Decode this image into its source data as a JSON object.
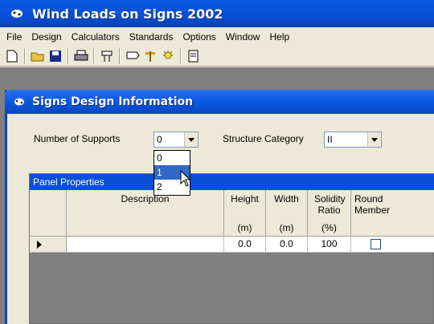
{
  "app": {
    "title": "Wind Loads on Signs 2002"
  },
  "menu": [
    "File",
    "Design",
    "Calculators",
    "Standards",
    "Options",
    "Window",
    "Help"
  ],
  "toolbar_icons": [
    "new-file-icon",
    "open-folder-icon",
    "save-icon",
    "print-icon",
    "sign-support-icon",
    "sign-icon",
    "structure-icon",
    "light-icon",
    "report-icon"
  ],
  "child": {
    "title": "Signs Design Information"
  },
  "form": {
    "supports_label": "Number of Supports",
    "supports_value": "0",
    "supports_options": [
      "0",
      "1",
      "2"
    ],
    "category_label": "Structure Category",
    "category_value": "II"
  },
  "grid": {
    "caption": "Panel Properties",
    "columns": [
      {
        "title": "Description",
        "unit": ""
      },
      {
        "title": "Height",
        "unit": "(m)"
      },
      {
        "title": "Width",
        "unit": "(m)"
      },
      {
        "title": "Solidity Ratio",
        "unit": "(%)"
      },
      {
        "title": "Round Member",
        "unit": ""
      }
    ],
    "row": {
      "description": "",
      "height": "0.0",
      "width": "0.0",
      "solidity": "100",
      "round": false
    }
  },
  "colors": {
    "title_blue": "#0a4fd6",
    "selection": "#316ac5"
  }
}
